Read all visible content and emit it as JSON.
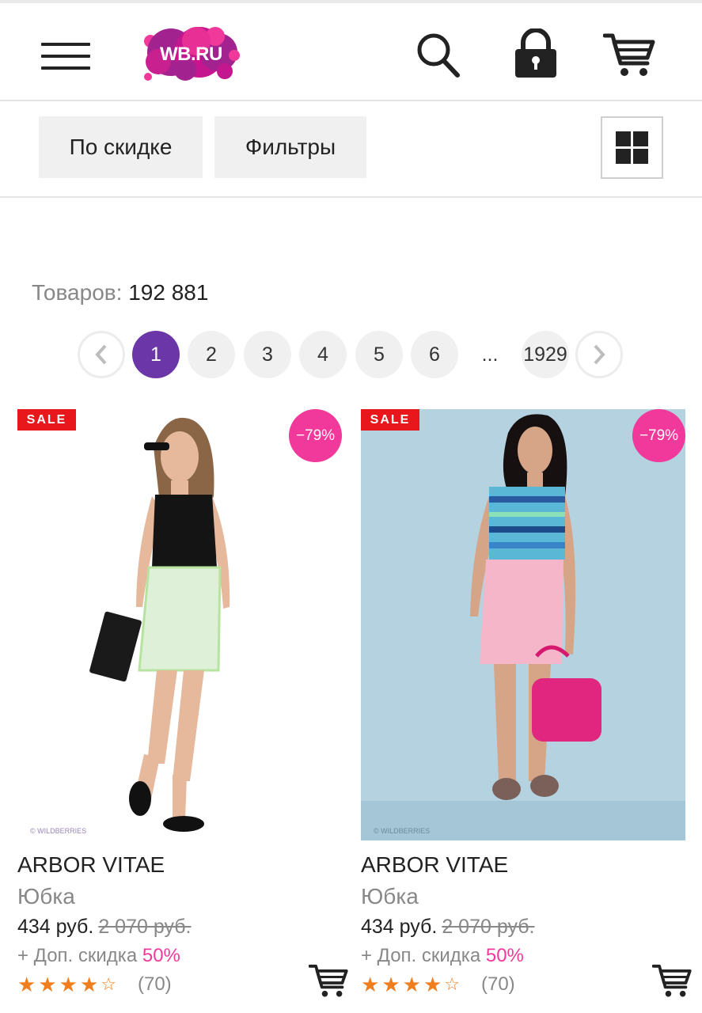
{
  "header": {
    "logo_text": "WB.RU",
    "colors": {
      "logo_purple": "#a2238f",
      "logo_pink": "#f0399a"
    },
    "icons": [
      "menu-icon",
      "search-icon",
      "lock-icon",
      "cart-icon"
    ]
  },
  "toolbar": {
    "sort_label": "По скидке",
    "filters_label": "Фильтры",
    "view_icon": "grid-view-icon"
  },
  "results": {
    "count_label": "Товаров:",
    "count_value": "192 881"
  },
  "pagination": {
    "prev_icon": "chevron-left-icon",
    "next_icon": "chevron-right-icon",
    "pages": [
      "1",
      "2",
      "3",
      "4",
      "5",
      "6"
    ],
    "ellipsis": "...",
    "last_page": "1929",
    "current": "1",
    "accent_color": "#6b36a8"
  },
  "products": [
    {
      "sale_badge": "SALE",
      "discount_badge": "−79%",
      "brand": "ARBOR VITAE",
      "type": "Юбка",
      "price": "434 руб.",
      "old_price": "2 070 руб.",
      "extra_discount_label": "+ Доп. скидка",
      "extra_discount_value": "50%",
      "rating": 4,
      "rating_max": 5,
      "reviews": "(70)",
      "watermark": "© WILDBERRIES"
    },
    {
      "sale_badge": "SALE",
      "discount_badge": "−79%",
      "brand": "ARBOR VITAE",
      "type": "Юбка",
      "price": "434 руб.",
      "old_price": "2 070 руб.",
      "extra_discount_label": "+ Доп. скидка",
      "extra_discount_value": "50%",
      "rating": 4,
      "rating_max": 5,
      "reviews": "(70)",
      "watermark": "© WILDBERRIES"
    }
  ]
}
